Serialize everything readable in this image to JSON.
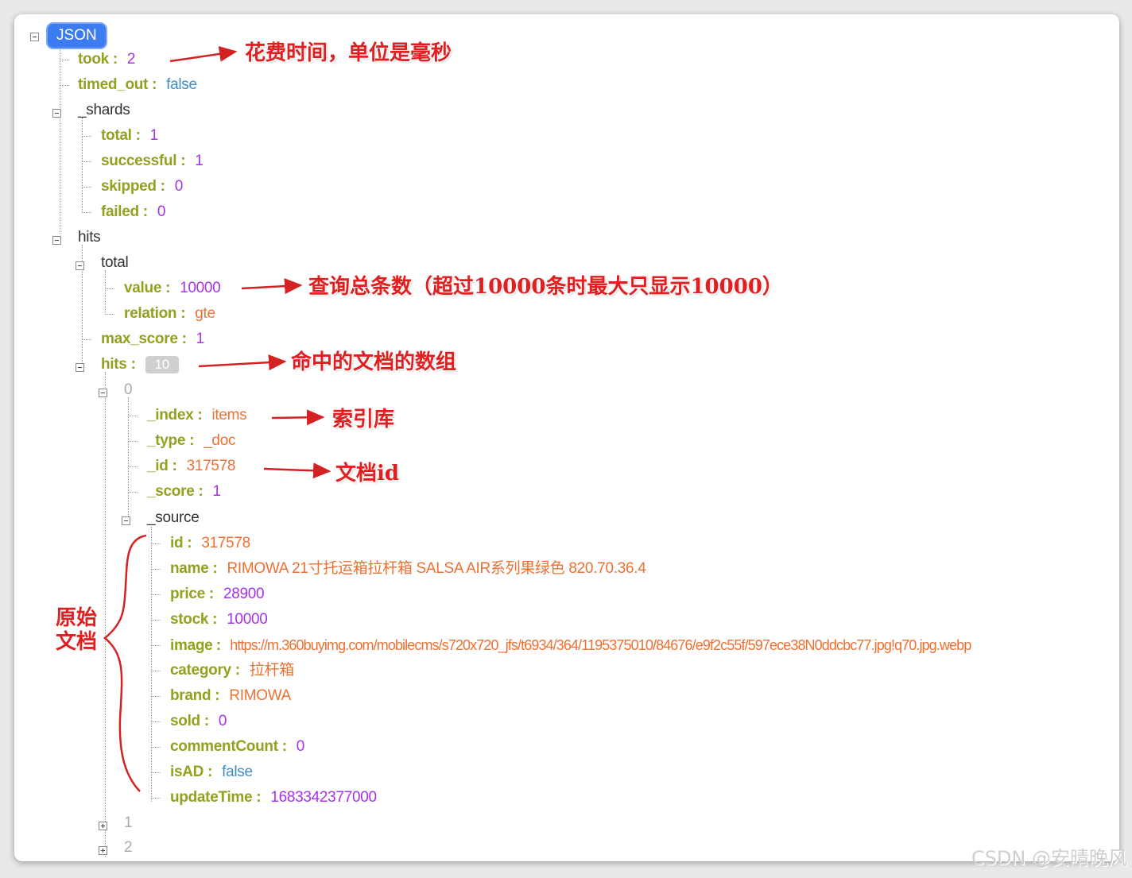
{
  "root_label": "JSON",
  "took": {
    "key": "took",
    "value": "2"
  },
  "timed_out": {
    "key": "timed_out",
    "value": "false"
  },
  "shards": {
    "key": "_shards",
    "total": {
      "key": "total",
      "value": "1"
    },
    "successful": {
      "key": "successful",
      "value": "1"
    },
    "skipped": {
      "key": "skipped",
      "value": "0"
    },
    "failed": {
      "key": "failed",
      "value": "0"
    }
  },
  "hits": {
    "key": "hits",
    "total": {
      "key": "total",
      "value": {
        "key": "value",
        "value": "10000"
      },
      "relation": {
        "key": "relation",
        "value": "gte"
      }
    },
    "max_score": {
      "key": "max_score",
      "value": "1"
    },
    "hits_array": {
      "key": "hits",
      "count": "10"
    },
    "item0": {
      "index_label": "0",
      "_index": {
        "key": "_index",
        "value": "items"
      },
      "_type": {
        "key": "_type",
        "value": "_doc"
      },
      "_id": {
        "key": "_id",
        "value": "317578"
      },
      "_score": {
        "key": "_score",
        "value": "1"
      },
      "source": {
        "key": "_source",
        "id": {
          "key": "id",
          "value": "317578"
        },
        "name": {
          "key": "name",
          "value": "RIMOWA 21寸托运箱拉杆箱 SALSA AIR系列果绿色 820.70.36.4"
        },
        "price": {
          "key": "price",
          "value": "28900"
        },
        "stock": {
          "key": "stock",
          "value": "10000"
        },
        "image": {
          "key": "image",
          "value": "https://m.360buyimg.com/mobilecms/s720x720_jfs/t6934/364/1195375010/84676/e9f2c55f/597ece38N0ddcbc77.jpg!q70.jpg.webp"
        },
        "category": {
          "key": "category",
          "value": "拉杆箱"
        },
        "brand": {
          "key": "brand",
          "value": "RIMOWA"
        },
        "sold": {
          "key": "sold",
          "value": "0"
        },
        "commentCount": {
          "key": "commentCount",
          "value": "0"
        },
        "isAD": {
          "key": "isAD",
          "value": "false"
        },
        "updateTime": {
          "key": "updateTime",
          "value": "1683342377000"
        }
      }
    },
    "item1_label": "1",
    "item2_label": "2"
  },
  "annotations": {
    "took": "花费时间，单位是毫秒",
    "total": "查询总条数（超过10000条时最大只显示10000）",
    "hits": "命中的文档的数组",
    "index": "索引库",
    "id": "文档id",
    "source": "原始文档"
  },
  "watermark": "CSDN @安晴晚风",
  "colors": {
    "key": "#92a21d",
    "number": "#a333e8",
    "string": "#ec7133",
    "boolean": "#3c8dc8",
    "annotation": "#e02020",
    "root_badge": "#3d7cf0"
  }
}
